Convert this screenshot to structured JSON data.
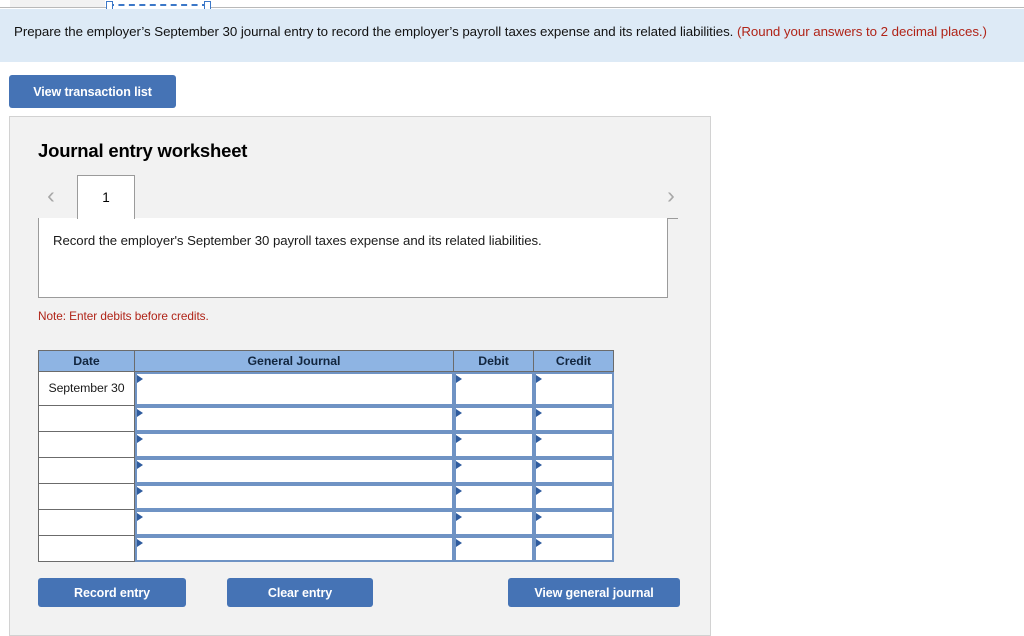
{
  "instruction": {
    "main_text": "Prepare the employer’s September 30 journal entry to record the employer’s payroll taxes expense and its related liabilities. ",
    "rounding_note": "(Round your answers to 2 decimal places.)"
  },
  "toolbar": {
    "view_transaction_list_label": "View transaction list"
  },
  "worksheet": {
    "title": "Journal entry worksheet",
    "tabs": [
      {
        "label": "1",
        "active": true
      }
    ],
    "nav": {
      "prev_icon": "‹",
      "next_icon": "›"
    },
    "description": "Record the employer's September 30 payroll taxes expense and its related liabilities.",
    "note": "Note: Enter debits before credits."
  },
  "journal_table": {
    "columns": [
      "Date",
      "General Journal",
      "Debit",
      "Credit"
    ],
    "rows": [
      {
        "date": "September 30",
        "general_journal": "",
        "debit": "",
        "credit": ""
      },
      {
        "date": "",
        "general_journal": "",
        "debit": "",
        "credit": ""
      },
      {
        "date": "",
        "general_journal": "",
        "debit": "",
        "credit": ""
      },
      {
        "date": "",
        "general_journal": "",
        "debit": "",
        "credit": ""
      },
      {
        "date": "",
        "general_journal": "",
        "debit": "",
        "credit": ""
      },
      {
        "date": "",
        "general_journal": "",
        "debit": "",
        "credit": ""
      },
      {
        "date": "",
        "general_journal": "",
        "debit": "",
        "credit": ""
      }
    ]
  },
  "actions": {
    "record_entry_label": "Record entry",
    "clear_entry_label": "Clear entry",
    "view_general_journal_label": "View general journal"
  },
  "colors": {
    "banner_bg": "#ddeaf6",
    "accent_red": "#b02418",
    "button_blue": "#4573b5",
    "table_header_blue": "#8eb4e3",
    "cell_border_blue": "#6f93c4",
    "panel_bg": "#f2f2f2"
  }
}
